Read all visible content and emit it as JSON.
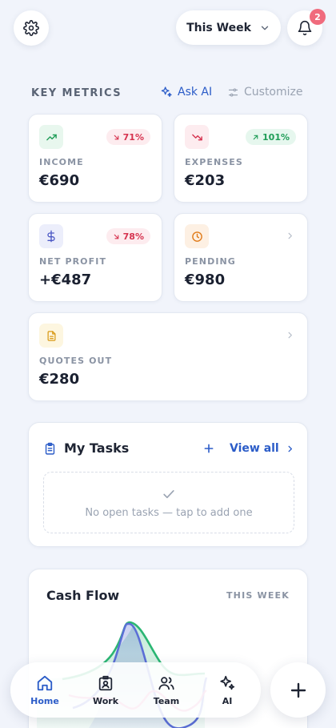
{
  "header": {
    "period_label": "This Week",
    "notification_count": "2",
    "icons": [
      "gear-icon",
      "chevron-down-icon",
      "bell-icon"
    ]
  },
  "metrics_section": {
    "title": "KEY METRICS",
    "ask_ai_label": "Ask AI",
    "customize_label": "Customize"
  },
  "metrics": [
    {
      "label": "INCOME",
      "value": "€690",
      "change": "71%",
      "direction": "down",
      "icon": "trend-up-icon"
    },
    {
      "label": "EXPENSES",
      "value": "€203",
      "change": "101%",
      "direction": "up",
      "icon": "trend-down-icon"
    },
    {
      "label": "NET PROFIT",
      "value": "+€487",
      "change": "78%",
      "direction": "down",
      "icon": "dollar-icon"
    },
    {
      "label": "PENDING",
      "value": "€980",
      "icon": "clock-icon"
    },
    {
      "label": "QUOTES OUT",
      "value": "€280",
      "icon": "document-icon"
    }
  ],
  "tasks": {
    "title": "My Tasks",
    "view_all_label": "View all",
    "empty_text": "No open tasks — tap to add one"
  },
  "cash_flow": {
    "title": "Cash Flow",
    "range_label": "THIS WEEK"
  },
  "nav": {
    "items": [
      {
        "label": "Home",
        "icon": "home-icon",
        "active": true
      },
      {
        "label": "Work",
        "icon": "briefcase-badge-icon",
        "active": false
      },
      {
        "label": "Team",
        "icon": "people-icon",
        "active": false
      },
      {
        "label": "AI",
        "icon": "sparkles-icon",
        "active": false
      }
    ],
    "fab_icon": "plus-icon"
  },
  "colors": {
    "accent": "#2b5cc8",
    "negative": "#d6334f",
    "positive": "#1f9d57",
    "income_line": "#2bb673",
    "expense_line": "#5b6fd6",
    "profit_line": "#e46fa8"
  }
}
